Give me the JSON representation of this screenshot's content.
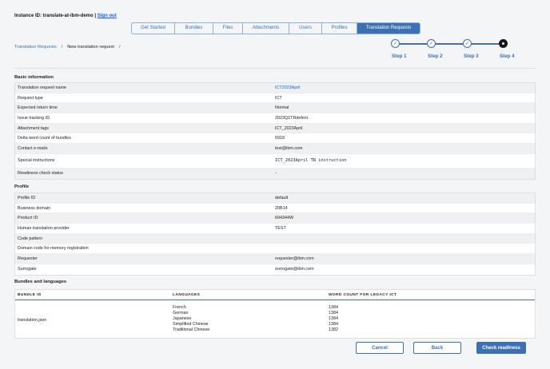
{
  "header": {
    "instance_label": "Instance ID: translate-at-ibm-demo",
    "separator": "|",
    "signout": "Sign out"
  },
  "tabs": [
    {
      "label": "Get Started",
      "active": false
    },
    {
      "label": "Bundles",
      "active": false
    },
    {
      "label": "Files",
      "active": false
    },
    {
      "label": "Attachments",
      "active": false
    },
    {
      "label": "Users",
      "active": false
    },
    {
      "label": "Profiles",
      "active": false
    },
    {
      "label": "Translation Requests",
      "active": true
    }
  ],
  "breadcrumb": {
    "root": "Translation Requests",
    "current": "New translation request",
    "sep": "/"
  },
  "steps": [
    {
      "label": "Step 1",
      "state": "done"
    },
    {
      "label": "Step 2",
      "state": "done"
    },
    {
      "label": "Step 3",
      "state": "done"
    },
    {
      "label": "Step 4",
      "state": "current"
    }
  ],
  "basic": {
    "title": "Basic information",
    "rows": [
      {
        "k": "Translation request name",
        "v": "ICT2023April"
      },
      {
        "k": "Request type",
        "v": "ICT"
      },
      {
        "k": "Expected return time",
        "v": "Normal"
      },
      {
        "k": "Issue tracking ID",
        "v": "2023Q1TRdefect"
      },
      {
        "k": "Attachment tags",
        "v": "ICT_2023April"
      },
      {
        "k": "Delta word count of bundles",
        "v": "6918"
      },
      {
        "k": "Contact e-mails",
        "v": "test@ibm.com"
      },
      {
        "k": "Special instructions",
        "v": "ICT_2023April TR instruction"
      },
      {
        "k": "Readiness check status",
        "v": "-"
      }
    ]
  },
  "profile": {
    "title": "Profile",
    "rows": [
      {
        "k": "Profile ID",
        "v": "default"
      },
      {
        "k": "Business domain",
        "v": "20B14"
      },
      {
        "k": "Product ID",
        "v": "694344W"
      },
      {
        "k": "Human translation provider",
        "v": "TEST"
      },
      {
        "k": "Code pattern",
        "v": ""
      },
      {
        "k": "Domain code for memory registration",
        "v": ""
      },
      {
        "k": "Requester",
        "v": "requester@ibm.com"
      },
      {
        "k": "Surrogate",
        "v": "surrogate@ibm.com"
      }
    ]
  },
  "bundles": {
    "title": "Bundles and languages",
    "headers": [
      "BUNDLE ID",
      "LANGUAGES",
      "WORD COUNT FOR LEGACY ICT"
    ],
    "bundle_id": "translation.json",
    "languages": [
      "French",
      "German",
      "Japanese",
      "Simplified Chinese",
      "Traditional Chinese"
    ],
    "counts": [
      "1384",
      "1384",
      "1384",
      "1384",
      "1382"
    ]
  },
  "buttons": {
    "cancel": "Cancel",
    "back": "Back",
    "check": "Check readiness"
  },
  "colors": {
    "accent": "#3d70b2",
    "link": "#0f62fe"
  }
}
